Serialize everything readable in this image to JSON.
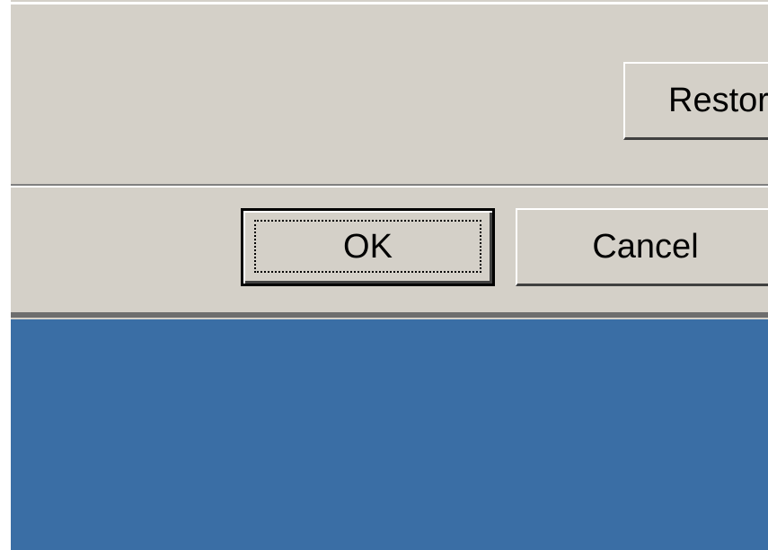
{
  "dialog": {
    "restore_label": "Restor",
    "ok_label": "OK",
    "cancel_label": "Cancel"
  },
  "colors": {
    "dialog_face": "#d4d0c8",
    "desktop_background": "#3a6ea5"
  }
}
